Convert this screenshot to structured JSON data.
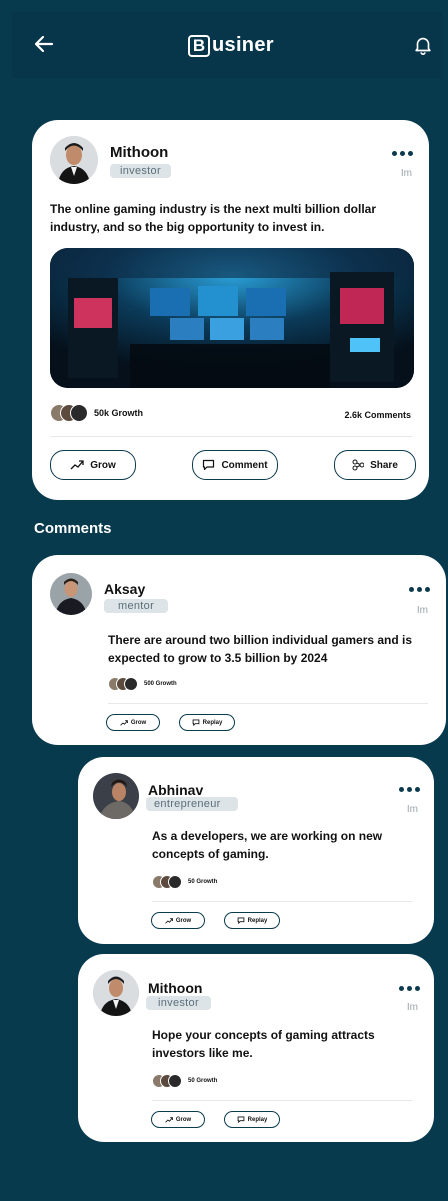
{
  "app": {
    "brand_letter": "B",
    "brand_rest": "usiner"
  },
  "post": {
    "author": "Mithoon",
    "role": "investor",
    "time": "Im",
    "text": "The online gaming industry is the next multi billion dollar industry, and so the big opportunity to invest in.",
    "image": "gaming-arcade-image",
    "growth": "50k Growth",
    "comments": "2.6k Comments",
    "actions": {
      "grow": "Grow",
      "comment": "Comment",
      "share": "Share"
    }
  },
  "comments_title": "Comments",
  "comments": [
    {
      "author": "Aksay",
      "role": "mentor",
      "time": "Im",
      "text": "There are around two billion individual gamers and is expected to grow to 3.5 billion by 2024",
      "growth": "500 Growth",
      "grow": "Grow",
      "reply": "Replay"
    },
    {
      "author": "Abhinav",
      "role": "entrepreneur",
      "time": "Im",
      "text": "As a developers, we are working on new concepts of gaming.",
      "growth": "50 Growth",
      "grow": "Grow",
      "reply": "Replay"
    },
    {
      "author": "Mithoon",
      "role": "investor",
      "time": "Im",
      "text": "Hope your concepts of gaming attracts investors like me.",
      "growth": "50 Growth",
      "grow": "Grow",
      "reply": "Replay"
    }
  ]
}
